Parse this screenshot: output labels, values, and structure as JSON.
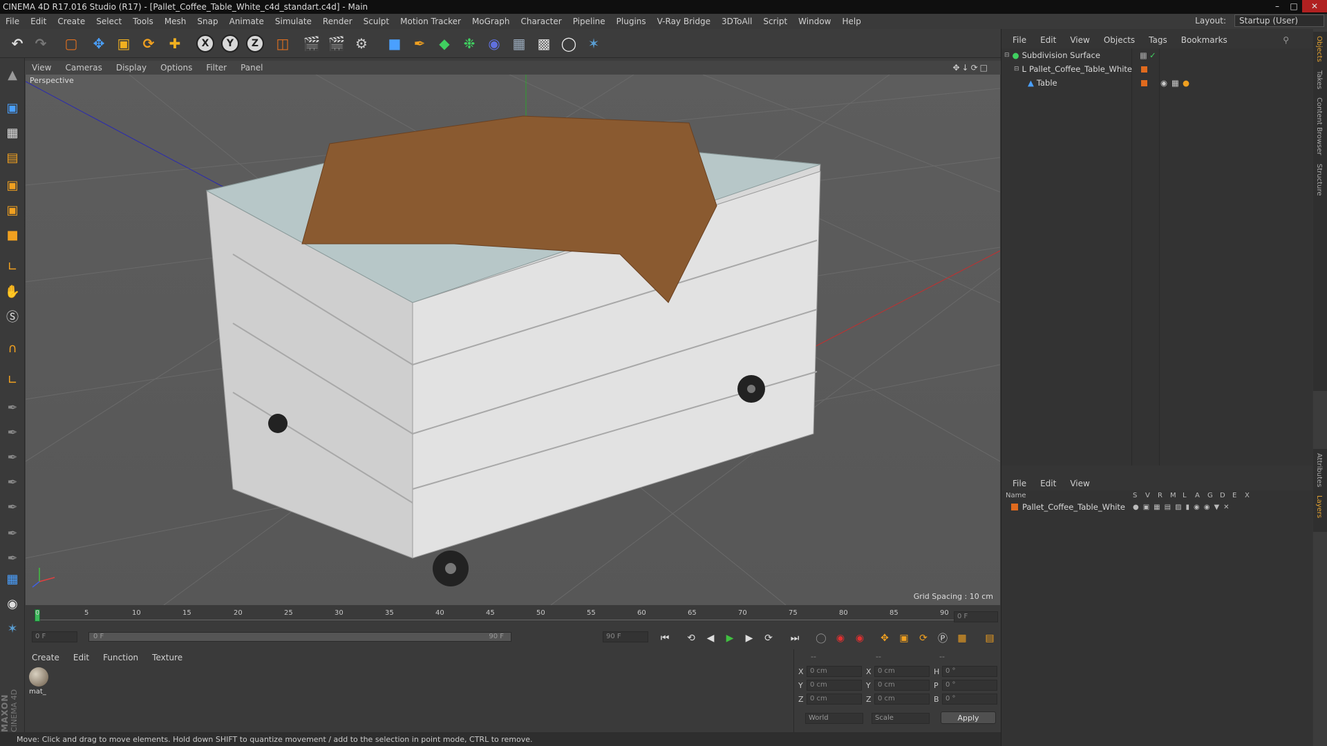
{
  "window": {
    "title": "CINEMA 4D R17.016 Studio (R17) - [Pallet_Coffee_Table_White_c4d_standart.c4d] - Main"
  },
  "menubar": {
    "items": [
      "File",
      "Edit",
      "Create",
      "Select",
      "Tools",
      "Mesh",
      "Snap",
      "Animate",
      "Simulate",
      "Render",
      "Sculpt",
      "Motion Tracker",
      "MoGraph",
      "Character",
      "Pipeline",
      "Plugins",
      "V-Ray Bridge",
      "3DToAll",
      "Script",
      "Window",
      "Help"
    ],
    "layout_label": "Layout:",
    "layout_value": "Startup (User)"
  },
  "toolbar": {
    "axis_x": "X",
    "axis_y": "Y",
    "axis_z": "Z"
  },
  "viewport": {
    "menu": [
      "View",
      "Cameras",
      "Display",
      "Options",
      "Filter",
      "Panel"
    ],
    "label": "Perspective",
    "grid_spacing": "Grid Spacing : 10 cm"
  },
  "timeline": {
    "ticks": [
      "0",
      "5",
      "10",
      "15",
      "20",
      "25",
      "30",
      "35",
      "40",
      "45",
      "50",
      "55",
      "60",
      "65",
      "70",
      "75",
      "80",
      "85",
      "90"
    ],
    "current_frame": "0 F",
    "start_frame": "0 F",
    "range_start": "0 F",
    "range_end": "90 F",
    "end_frame": "90 F"
  },
  "material_manager": {
    "menu": [
      "Create",
      "Edit",
      "Function",
      "Texture"
    ],
    "materials": [
      {
        "name": "mat_"
      }
    ]
  },
  "coordinates": {
    "headers": [
      "--",
      "--",
      "--"
    ],
    "rows": [
      {
        "a": "X",
        "pos": "0 cm",
        "b": "X",
        "size": "0 cm",
        "c": "H",
        "rot": "0 °"
      },
      {
        "a": "Y",
        "pos": "0 cm",
        "b": "Y",
        "size": "0 cm",
        "c": "P",
        "rot": "0 °"
      },
      {
        "a": "Z",
        "pos": "0 cm",
        "b": "Z",
        "size": "0 cm",
        "c": "B",
        "rot": "0 °"
      }
    ],
    "mode": "World",
    "transform": "Scale",
    "apply": "Apply"
  },
  "status": {
    "text": "Move: Click and drag to move elements. Hold down SHIFT to quantize movement / add to the selection in point mode, CTRL to remove."
  },
  "object_manager": {
    "menu": [
      "File",
      "Edit",
      "View",
      "Objects",
      "Tags",
      "Bookmarks"
    ],
    "objects": [
      {
        "name": "Subdivision Surface"
      },
      {
        "name": "Pallet_Coffee_Table_White"
      },
      {
        "name": "Table"
      }
    ]
  },
  "layer_manager": {
    "menu": [
      "File",
      "Edit",
      "View"
    ],
    "col_name": "Name",
    "cols": [
      "S",
      "V",
      "R",
      "M",
      "L",
      "A",
      "G",
      "D",
      "E",
      "X"
    ],
    "layers": [
      {
        "name": "Pallet_Coffee_Table_White",
        "color": "#e06a1e"
      }
    ]
  },
  "side_tabs": [
    "Objects",
    "Takes",
    "Content Browser",
    "Structure",
    "Attributes",
    "Layers"
  ],
  "brand": {
    "line1": "MAXON",
    "line2": "CINEMA 4D"
  }
}
